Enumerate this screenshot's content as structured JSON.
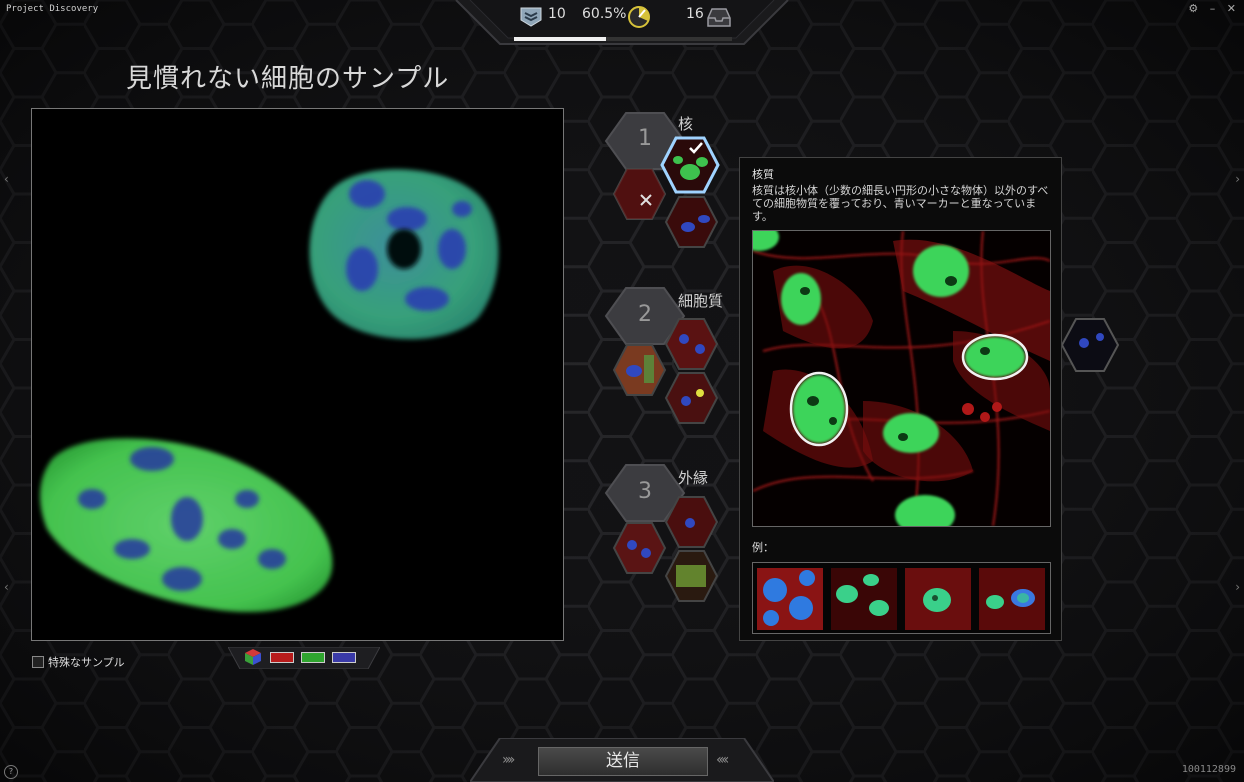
{
  "app": {
    "title": "Project Discovery",
    "window_controls": [
      "⚙",
      "–",
      "✕"
    ]
  },
  "topbar": {
    "rank": "10",
    "accuracy": "60.5%",
    "samples": "16",
    "progress": 0.42
  },
  "heading": "見慣れない細胞のサンプル",
  "special_sample_label": "特殊なサンプル",
  "categories": [
    {
      "number": "1",
      "label": "核"
    },
    {
      "number": "2",
      "label": "細胞質"
    },
    {
      "number": "3",
      "label": "外縁"
    }
  ],
  "tooltip": {
    "title": "核質",
    "description": "核質は核小体（少数の細長い円形の小さな物体）以外のすべての細胞物質を覆っており、青いマーカーと重なっています。",
    "examples_label": "例："
  },
  "submit": {
    "label": "送信"
  },
  "sample_id": "100112899",
  "help": "?",
  "colors": {
    "red": "#b81c1c",
    "green": "#2fa52f",
    "blue": "#3a3aa8",
    "accent": "#5aa0e0"
  },
  "icons": [
    "rank-icon",
    "gauge-icon",
    "inbox-icon",
    "check-icon",
    "close-icon",
    "rgb-cube-icon",
    "help-icon"
  ]
}
